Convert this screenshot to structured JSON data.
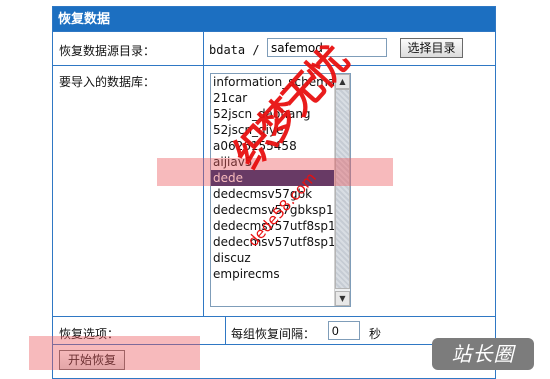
{
  "panel": {
    "title": "恢复数据"
  },
  "source_dir": {
    "label": "恢复数据源目录：",
    "prefix": "bdata /",
    "value": "safemod",
    "select_button": "选择目录"
  },
  "databases": {
    "label": "要导入的数据库：",
    "items": [
      "information_schema",
      "21car",
      "52jscn_daohang",
      "52jscn_qiye",
      "a0626155458",
      "aijiav5",
      "dede",
      "dedecmsv57gbk",
      "dedecmsv57gbksp1",
      "dedecmsv57utf8sp1",
      "dedecmsv57utf8sp12",
      "discuz",
      "empirecms"
    ],
    "selected": "dede"
  },
  "options": {
    "label": "恢复选项：",
    "interval_label": "每组恢复间隔：",
    "interval_value": "0",
    "interval_unit": "秒"
  },
  "start_button": "开始恢复",
  "watermark": {
    "main": "织梦无忧",
    "sub": "dede58.com"
  },
  "site_logo": "站长圈",
  "colors": {
    "title_bar": "#1c6fc1",
    "border": "#2f78c4",
    "selection": "#0a246a",
    "highlight": "#eb5a5f",
    "watermark": "#e81010"
  }
}
